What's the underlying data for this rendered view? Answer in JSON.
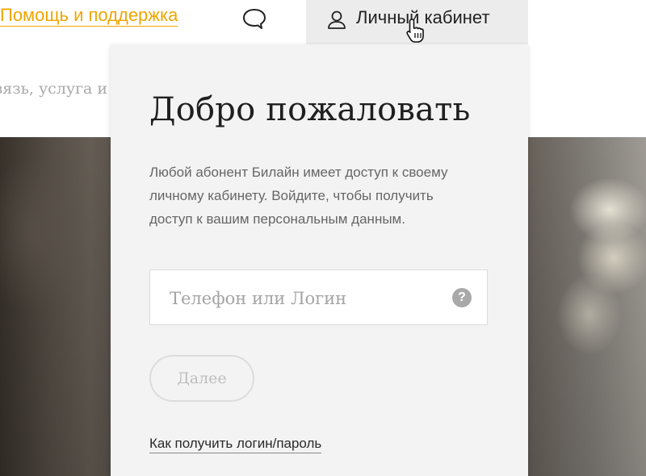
{
  "header": {
    "help_link": "Помощь и поддержка",
    "account_label": "Личный кабинет"
  },
  "nav": {
    "partial_item": "Связь, услуга и финансы"
  },
  "login_panel": {
    "title": "Добро пожаловать",
    "description": "Любой абонент Билайн имеет доступ к своему личному кабинету. Войдите, чтобы получить доступ к вашим персональным данным.",
    "login_placeholder": "Телефон или Логин",
    "login_value": "",
    "help_icon_glyph": "?",
    "next_button": "Далее",
    "next_enabled": false,
    "howto_link": "Как получить логин/пароль"
  },
  "icons": {
    "chat": "chat-bubble-icon",
    "user": "user-icon",
    "help": "question-icon",
    "cursor": "hand-pointer-icon"
  },
  "colors": {
    "brand_accent": "#f0a500",
    "panel_bg": "#f3f3f4",
    "account_tab_bg": "#ececec"
  }
}
